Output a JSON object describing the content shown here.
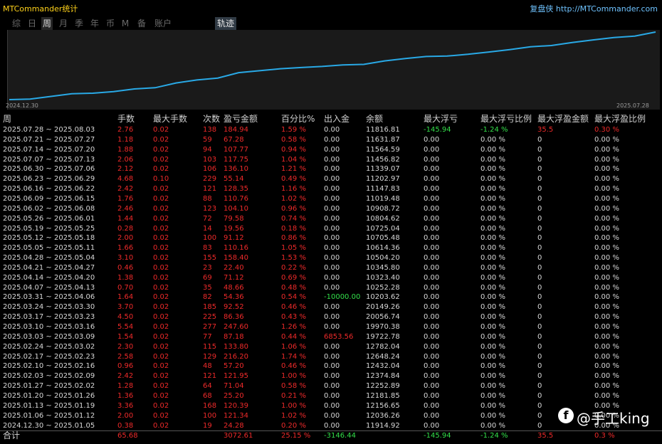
{
  "header": {
    "app_title": "MTCommander统计",
    "site_link": "复盘侠 http://MTCommander.com"
  },
  "tabs": [
    "综",
    "日",
    "周",
    "月",
    "季",
    "年",
    "币",
    "M",
    "备",
    "账户"
  ],
  "active_tab": "周",
  "trail_button": "轨迹",
  "equity_chart": {
    "start_label": "2024.12.30",
    "end_label": "2025.07.28",
    "line_color": "#29a9e6",
    "balances": [
      11914.92,
      12036.26,
      12156.65,
      12181.85,
      12252.89,
      12374.84,
      12432.04,
      12648.24,
      12782.04,
      19722.78,
      19970.38,
      20056.74,
      20149.26,
      10203.62,
      10252.28,
      10323.4,
      10345.8,
      10504.2,
      10614.36,
      10705.48,
      10725.04,
      10804.62,
      10908.72,
      11019.48,
      11147.83,
      11202.97,
      11339.07,
      11456.82,
      11564.59,
      11631.87,
      11816.81
    ]
  },
  "columns": [
    "周",
    "手数",
    "最大手数",
    "次数",
    "盈亏金额",
    "百分比%",
    "出入金",
    "余额",
    "最大浮亏",
    "最大浮亏比例",
    "最大浮盈金额",
    "最大浮盈比例"
  ],
  "rows": [
    [
      "2025.07.28 ~ 2025.08.03",
      "2.76",
      "0.02",
      "138",
      "184.94",
      "1.59 %",
      "0.00",
      "11816.81",
      "-145.94",
      "-1.24 %",
      "35.5",
      "0.30 %"
    ],
    [
      "2025.07.21 ~ 2025.07.27",
      "1.18",
      "0.02",
      "59",
      "67.28",
      "0.58 %",
      "0.00",
      "11631.87",
      "0.00",
      "0.00 %",
      "0",
      "0.00 %"
    ],
    [
      "2025.07.14 ~ 2025.07.20",
      "1.88",
      "0.02",
      "94",
      "107.77",
      "0.94 %",
      "0.00",
      "11564.59",
      "0.00",
      "0.00 %",
      "0",
      "0.00 %"
    ],
    [
      "2025.07.07 ~ 2025.07.13",
      "2.06",
      "0.02",
      "103",
      "117.75",
      "1.04 %",
      "0.00",
      "11456.82",
      "0.00",
      "0.00 %",
      "0",
      "0.00 %"
    ],
    [
      "2025.06.30 ~ 2025.07.06",
      "2.12",
      "0.02",
      "106",
      "136.10",
      "1.21 %",
      "0.00",
      "11339.07",
      "0.00",
      "0.00 %",
      "0",
      "0.00 %"
    ],
    [
      "2025.06.23 ~ 2025.06.29",
      "4.68",
      "0.10",
      "229",
      "55.14",
      "0.49 %",
      "0.00",
      "11202.97",
      "0.00",
      "0.00 %",
      "0",
      "0.00 %"
    ],
    [
      "2025.06.16 ~ 2025.06.22",
      "2.42",
      "0.02",
      "121",
      "128.35",
      "1.16 %",
      "0.00",
      "11147.83",
      "0.00",
      "0.00 %",
      "0",
      "0.00 %"
    ],
    [
      "2025.06.09 ~ 2025.06.15",
      "1.76",
      "0.02",
      "88",
      "110.76",
      "1.02 %",
      "0.00",
      "11019.48",
      "0.00",
      "0.00 %",
      "0",
      "0.00 %"
    ],
    [
      "2025.06.02 ~ 2025.06.08",
      "2.46",
      "0.02",
      "123",
      "104.10",
      "0.96 %",
      "0.00",
      "10908.72",
      "0.00",
      "0.00 %",
      "0",
      "0.00 %"
    ],
    [
      "2025.05.26 ~ 2025.06.01",
      "1.44",
      "0.02",
      "72",
      "79.58",
      "0.74 %",
      "0.00",
      "10804.62",
      "0.00",
      "0.00 %",
      "0",
      "0.00 %"
    ],
    [
      "2025.05.19 ~ 2025.05.25",
      "0.28",
      "0.02",
      "14",
      "19.56",
      "0.18 %",
      "0.00",
      "10725.04",
      "0.00",
      "0.00 %",
      "0",
      "0.00 %"
    ],
    [
      "2025.05.12 ~ 2025.05.18",
      "2.00",
      "0.02",
      "100",
      "91.12",
      "0.86 %",
      "0.00",
      "10705.48",
      "0.00",
      "0.00 %",
      "0",
      "0.00 %"
    ],
    [
      "2025.05.05 ~ 2025.05.11",
      "1.66",
      "0.02",
      "83",
      "110.16",
      "1.05 %",
      "0.00",
      "10614.36",
      "0.00",
      "0.00 %",
      "0",
      "0.00 %"
    ],
    [
      "2025.04.28 ~ 2025.05.04",
      "3.10",
      "0.02",
      "155",
      "158.40",
      "1.53 %",
      "0.00",
      "10504.20",
      "0.00",
      "0.00 %",
      "0",
      "0.00 %"
    ],
    [
      "2025.04.21 ~ 2025.04.27",
      "0.46",
      "0.02",
      "23",
      "22.40",
      "0.22 %",
      "0.00",
      "10345.80",
      "0.00",
      "0.00 %",
      "0",
      "0.00 %"
    ],
    [
      "2025.04.14 ~ 2025.04.20",
      "1.38",
      "0.02",
      "69",
      "71.12",
      "0.69 %",
      "0.00",
      "10323.40",
      "0.00",
      "0.00 %",
      "0",
      "0.00 %"
    ],
    [
      "2025.04.07 ~ 2025.04.13",
      "0.70",
      "0.02",
      "35",
      "48.66",
      "0.48 %",
      "0.00",
      "10252.28",
      "0.00",
      "0.00 %",
      "0",
      "0.00 %"
    ],
    [
      "2025.03.31 ~ 2025.04.06",
      "1.64",
      "0.02",
      "82",
      "54.36",
      "0.54 %",
      "-10000.00",
      "10203.62",
      "0.00",
      "0.00 %",
      "0",
      "0.00 %"
    ],
    [
      "2025.03.24 ~ 2025.03.30",
      "3.70",
      "0.02",
      "185",
      "92.52",
      "0.46 %",
      "0.00",
      "20149.26",
      "0.00",
      "0.00 %",
      "0",
      "0.00 %"
    ],
    [
      "2025.03.17 ~ 2025.03.23",
      "4.50",
      "0.02",
      "225",
      "86.36",
      "0.43 %",
      "0.00",
      "20056.74",
      "0.00",
      "0.00 %",
      "0",
      "0.00 %"
    ],
    [
      "2025.03.10 ~ 2025.03.16",
      "5.54",
      "0.02",
      "277",
      "247.60",
      "1.26 %",
      "0.00",
      "19970.38",
      "0.00",
      "0.00 %",
      "0",
      "0.00 %"
    ],
    [
      "2025.03.03 ~ 2025.03.09",
      "1.54",
      "0.02",
      "77",
      "87.18",
      "0.44 %",
      "6853.56",
      "19722.78",
      "0.00",
      "0.00 %",
      "0",
      "0.00 %"
    ],
    [
      "2025.02.24 ~ 2025.03.02",
      "2.30",
      "0.02",
      "115",
      "133.80",
      "1.06 %",
      "0.00",
      "12782.04",
      "0.00",
      "0.00 %",
      "0",
      "0.00 %"
    ],
    [
      "2025.02.17 ~ 2025.02.23",
      "2.58",
      "0.02",
      "129",
      "216.20",
      "1.74 %",
      "0.00",
      "12648.24",
      "0.00",
      "0.00 %",
      "0",
      "0.00 %"
    ],
    [
      "2025.02.10 ~ 2025.02.16",
      "0.96",
      "0.02",
      "48",
      "57.20",
      "0.46 %",
      "0.00",
      "12432.04",
      "0.00",
      "0.00 %",
      "0",
      "0.00 %"
    ],
    [
      "2025.02.03 ~ 2025.02.09",
      "2.42",
      "0.02",
      "121",
      "121.95",
      "1.00 %",
      "0.00",
      "12374.84",
      "0.00",
      "0.00 %",
      "0",
      "0.00 %"
    ],
    [
      "2025.01.27 ~ 2025.02.02",
      "1.28",
      "0.02",
      "64",
      "71.04",
      "0.58 %",
      "0.00",
      "12252.89",
      "0.00",
      "0.00 %",
      "0",
      "0.00 %"
    ],
    [
      "2025.01.20 ~ 2025.01.26",
      "1.36",
      "0.02",
      "68",
      "25.20",
      "0.21 %",
      "0.00",
      "12181.85",
      "0.00",
      "0.00 %",
      "0",
      "0.00 %"
    ],
    [
      "2025.01.13 ~ 2025.01.19",
      "3.36",
      "0.02",
      "168",
      "120.39",
      "1.00 %",
      "0.00",
      "12156.65",
      "0.00",
      "0.00 %",
      "0",
      "0.00 %"
    ],
    [
      "2025.01.06 ~ 2025.01.12",
      "2.00",
      "0.02",
      "100",
      "121.34",
      "1.02 %",
      "0.00",
      "12036.26",
      "0.00",
      "0.00 %",
      "0",
      "0.00 %"
    ],
    [
      "2024.12.30 ~ 2025.01.05",
      "0.38",
      "0.02",
      "19",
      "24.28",
      "0.20 %",
      "0.00",
      "11914.92",
      "0.00",
      "0.00 %",
      "0",
      "0.00 %"
    ]
  ],
  "total_row": [
    "合计",
    "65.68",
    "",
    "",
    "3072.61",
    "25.15 %",
    "-3146.44",
    "",
    "-145.94",
    "-1.24 %",
    "35.5",
    "0.3 %"
  ],
  "watermark": "@手工king",
  "colors": {
    "red": "#ee2a2a",
    "green": "#33e04a",
    "yellow": "#ffd21a",
    "link": "#6fc3ff"
  }
}
